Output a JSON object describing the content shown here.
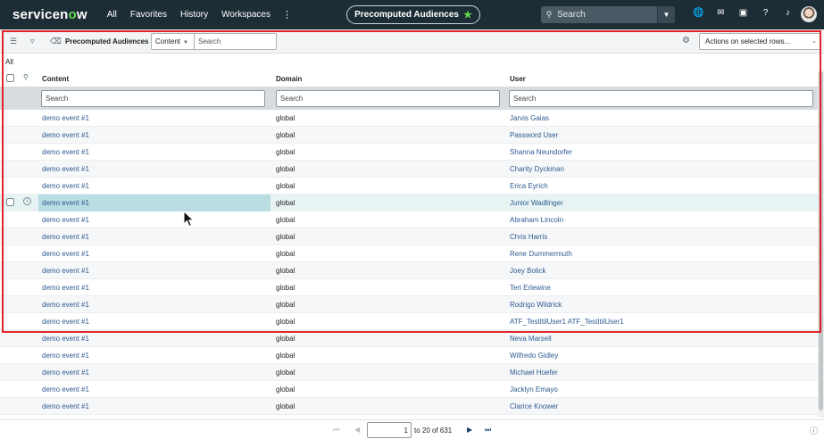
{
  "nav": {
    "logo_a": "servicen",
    "logo_o": "o",
    "logo_b": "w",
    "items": [
      "All",
      "Favorites",
      "History",
      "Workspaces"
    ],
    "more": "⋮",
    "context_title": "Precomputed Audiences",
    "star": "★",
    "search_placeholder": "Search",
    "icons": [
      "globe-icon",
      "chat-icon",
      "screen-icon",
      "help-icon",
      "bell-icon"
    ]
  },
  "toolbar": {
    "title": "Precomputed Audiences",
    "field_select": "Content",
    "search_placeholder": "Search",
    "actions_label": "Actions on selected rows..."
  },
  "breadcrumb": "All",
  "table": {
    "columns": [
      "Content",
      "Domain",
      "User"
    ],
    "search_placeholder": "Search",
    "rows": [
      {
        "content": "demo event #1",
        "domain": "global",
        "user": "Jarvis Gaias"
      },
      {
        "content": "demo event #1",
        "domain": "global",
        "user": "Password User"
      },
      {
        "content": "demo event #1",
        "domain": "global",
        "user": "Shanna Neundorfer"
      },
      {
        "content": "demo event #1",
        "domain": "global",
        "user": "Charity Dyckman"
      },
      {
        "content": "demo event #1",
        "domain": "global",
        "user": "Erica Eyrich"
      },
      {
        "content": "demo event #1",
        "domain": "global",
        "user": "Junior Wadlinger"
      },
      {
        "content": "demo event #1",
        "domain": "global",
        "user": "Abraham Lincoln"
      },
      {
        "content": "demo event #1",
        "domain": "global",
        "user": "Chris Harris"
      },
      {
        "content": "demo event #1",
        "domain": "global",
        "user": "Rene Dummermuth"
      },
      {
        "content": "demo event #1",
        "domain": "global",
        "user": "Joey Bolick"
      },
      {
        "content": "demo event #1",
        "domain": "global",
        "user": "Teri Erlewine"
      },
      {
        "content": "demo event #1",
        "domain": "global",
        "user": "Rodrigo Wildrick"
      },
      {
        "content": "demo event #1",
        "domain": "global",
        "user": "ATF_TestItilUser1 ATF_TestItilUser1"
      },
      {
        "content": "demo event #1",
        "domain": "global",
        "user": "Neva Marsell"
      },
      {
        "content": "demo event #1",
        "domain": "global",
        "user": "Wilfredo Gidley"
      },
      {
        "content": "demo event #1",
        "domain": "global",
        "user": "Michael Hoefer"
      },
      {
        "content": "demo event #1",
        "domain": "global",
        "user": "Jacklyn Emayo"
      },
      {
        "content": "demo event #1",
        "domain": "global",
        "user": "Clarice Knower"
      }
    ]
  },
  "pager": {
    "current": "1",
    "range_text": "to 20 of 631",
    "first": "⏮",
    "prev": "◀",
    "next": "▶",
    "last": "⏭"
  },
  "colors": {
    "nav_bg": "#1d2d36",
    "accent_green": "#62d84e",
    "link": "#2e5b91",
    "highlight": "#b9dde3",
    "selection_frame": "#e0242b"
  }
}
